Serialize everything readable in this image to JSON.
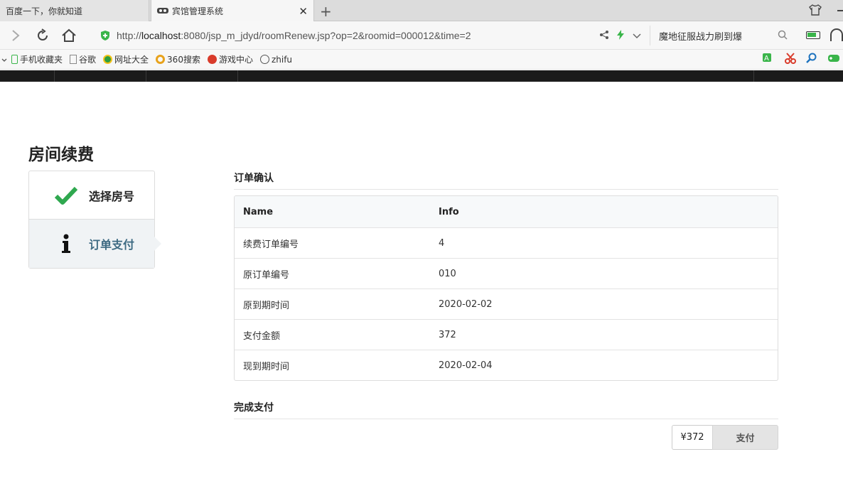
{
  "browser": {
    "tabs": [
      {
        "title": "百度一下，你就知道",
        "active": false
      },
      {
        "title": "宾馆管理系统",
        "active": true
      }
    ],
    "url": {
      "scheme": "http://",
      "host": "localhost",
      "rest": ":8080/jsp_m_jdyd/roomRenew.jsp?op=2&roomid=000012&time=2"
    },
    "search_text": "魔地征服战力刷到爆",
    "bookmarks": [
      "手机收藏夹",
      "谷歌",
      "网址大全",
      "360搜索",
      "游戏中心",
      "zhifu"
    ]
  },
  "page": {
    "title": "房间续费",
    "steps": [
      {
        "label": "选择房号",
        "state": "done",
        "icon": "check-icon"
      },
      {
        "label": "订单支付",
        "state": "active",
        "icon": "info-icon"
      }
    ],
    "order_section_title": "订单确认",
    "table": {
      "headers": [
        "Name",
        "Info"
      ],
      "rows": [
        [
          "续费订单编号",
          "4"
        ],
        [
          "原订单编号",
          "010"
        ],
        [
          "原到期时间",
          "2020-02-02"
        ],
        [
          "支付金额",
          "372"
        ],
        [
          "现到期时间",
          "2020-02-04"
        ]
      ]
    },
    "pay_section_title": "完成支付",
    "pay_amount": "¥372",
    "pay_button": "支付"
  },
  "colors": {
    "check": "#2fa84f",
    "active_step_text": "#3d6a82",
    "appbar": "#1b1b1b"
  }
}
